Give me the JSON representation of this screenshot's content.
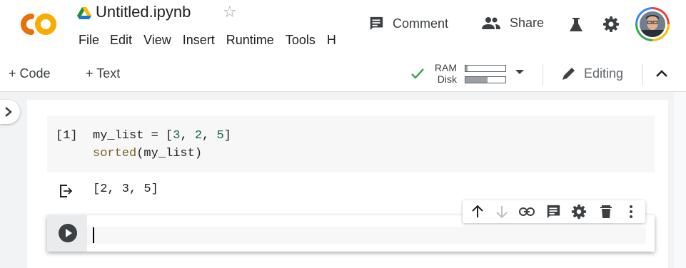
{
  "header": {
    "logo": "colab-logo",
    "notebook_title": "Untitled.ipynb",
    "star_glyph": "☆",
    "menu": [
      "File",
      "Edit",
      "View",
      "Insert",
      "Runtime",
      "Tools",
      "H"
    ],
    "comment_label": "Comment",
    "share_label": "Share",
    "icons": [
      "drive-icon",
      "comment-icon",
      "people-icon",
      "flask-icon",
      "gear-icon",
      "avatar"
    ]
  },
  "toolbar": {
    "add_code_label": "+ Code",
    "add_text_label": "+ Text",
    "ram_label": "RAM",
    "disk_label": "Disk",
    "ram_usage_fraction": 0.05,
    "disk_usage_fraction": 0.55,
    "editing_label": "Editing"
  },
  "notebook": {
    "cells": [
      {
        "type": "code",
        "execution_count": "[1]",
        "source_line_1": {
          "name": "my_list",
          "op": " = [",
          "n1": "3",
          "sep1": ", ",
          "n2": "2",
          "sep2": ", ",
          "n3": "5",
          "close": "]"
        },
        "source_line_2": {
          "fn": "sorted",
          "args": "(my_list)"
        },
        "output": "[2, 3, 5]"
      },
      {
        "type": "code",
        "source": "",
        "active": true
      }
    ],
    "cell_toolbar": [
      "move-up-icon",
      "move-down-icon",
      "link-icon",
      "comment-icon",
      "settings-icon",
      "delete-icon",
      "more-icon"
    ]
  },
  "colors": {
    "colab_orange": "#f9ab00",
    "colab_orange_dark": "#e8710a",
    "check_green": "#34a853",
    "number_green": "#116644",
    "function_brown": "#795e26",
    "icon_gray": "#5f6368"
  }
}
